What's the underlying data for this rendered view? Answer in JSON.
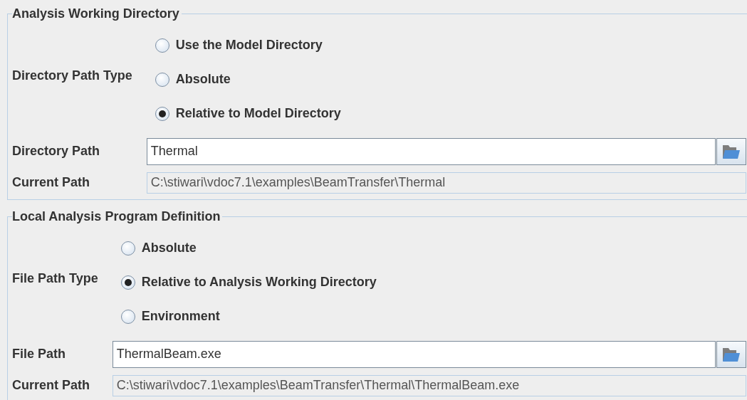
{
  "sections": [
    {
      "title": "Analysis Working Directory",
      "path_type": {
        "label": "Directory Path Type",
        "options": [
          {
            "label": "Use the Model Directory",
            "selected": false
          },
          {
            "label": "Absolute",
            "selected": false
          },
          {
            "label": "Relative to Model Directory",
            "selected": true
          }
        ]
      },
      "path": {
        "label": "Directory Path",
        "value": "Thermal"
      },
      "current_path": {
        "label": "Current Path",
        "value": "C:\\stiwari\\vdoc7.1\\examples\\BeamTransfer\\Thermal"
      }
    },
    {
      "title": "Local Analysis Program Definition",
      "path_type": {
        "label": "File Path Type",
        "options": [
          {
            "label": "Absolute",
            "selected": false
          },
          {
            "label": "Relative to Analysis Working Directory",
            "selected": true
          },
          {
            "label": "Environment",
            "selected": false
          }
        ]
      },
      "path": {
        "label": "File Path",
        "value": "ThermalBeam.exe"
      },
      "current_path": {
        "label": "Current Path",
        "value": "C:\\stiwari\\vdoc7.1\\examples\\BeamTransfer\\Thermal\\ThermalBeam.exe"
      }
    }
  ]
}
